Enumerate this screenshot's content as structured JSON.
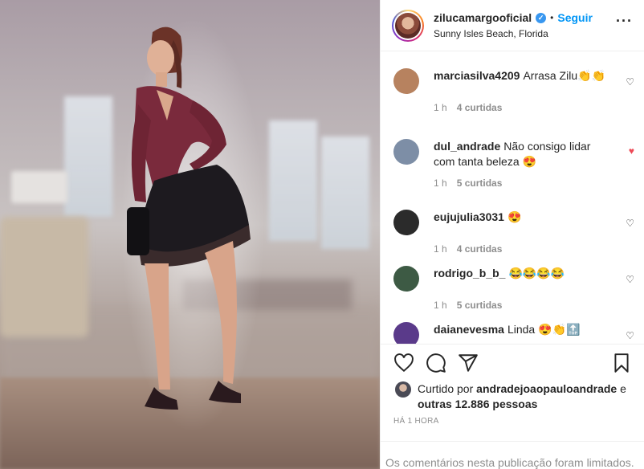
{
  "header": {
    "username": "zilucamargooficial",
    "verified_icon": "verified-badge-icon",
    "separator": "•",
    "follow_label": "Seguir",
    "location": "Sunny Isles Beach, Florida",
    "more_icon": "more-options-icon"
  },
  "comments": [
    {
      "user": "marciasilva4209",
      "text": "Arrasa Zilu👏👏",
      "time": "1 h",
      "likes": "4 curtidas",
      "liked": false,
      "avatar_color": "#b7825f"
    },
    {
      "user": "dul_andrade",
      "text": "Não consigo lidar com tanta beleza 😍",
      "time": "1 h",
      "likes": "5 curtidas",
      "liked": true,
      "avatar_color": "#7d8ea6"
    },
    {
      "user": "eujujulia3031",
      "text": "😍",
      "time": "1 h",
      "likes": "4 curtidas",
      "liked": false,
      "avatar_color": "#2b2b2b"
    },
    {
      "user": "rodrigo_b_b_",
      "text": "😂😂😂😂",
      "time": "1 h",
      "likes": "5 curtidas",
      "liked": false,
      "avatar_color": "#3d5a44"
    },
    {
      "user": "daianevesma",
      "text": "Linda 😍👏🔝",
      "time": "",
      "likes": "",
      "liked": false,
      "avatar_color": "#5a3a8a"
    }
  ],
  "actions": {
    "like_icon": "heart-icon",
    "comment_icon": "comment-icon",
    "share_icon": "share-icon",
    "save_icon": "bookmark-icon"
  },
  "likes_summary": {
    "prefix": "Curtido por",
    "user": "andradejoaopauloandrade",
    "conjunction": "e",
    "others": "outras 12.886 pessoas"
  },
  "timestamp": "HÁ 1 HORA",
  "comments_limited": "Os comentários nesta publicação foram limitados."
}
